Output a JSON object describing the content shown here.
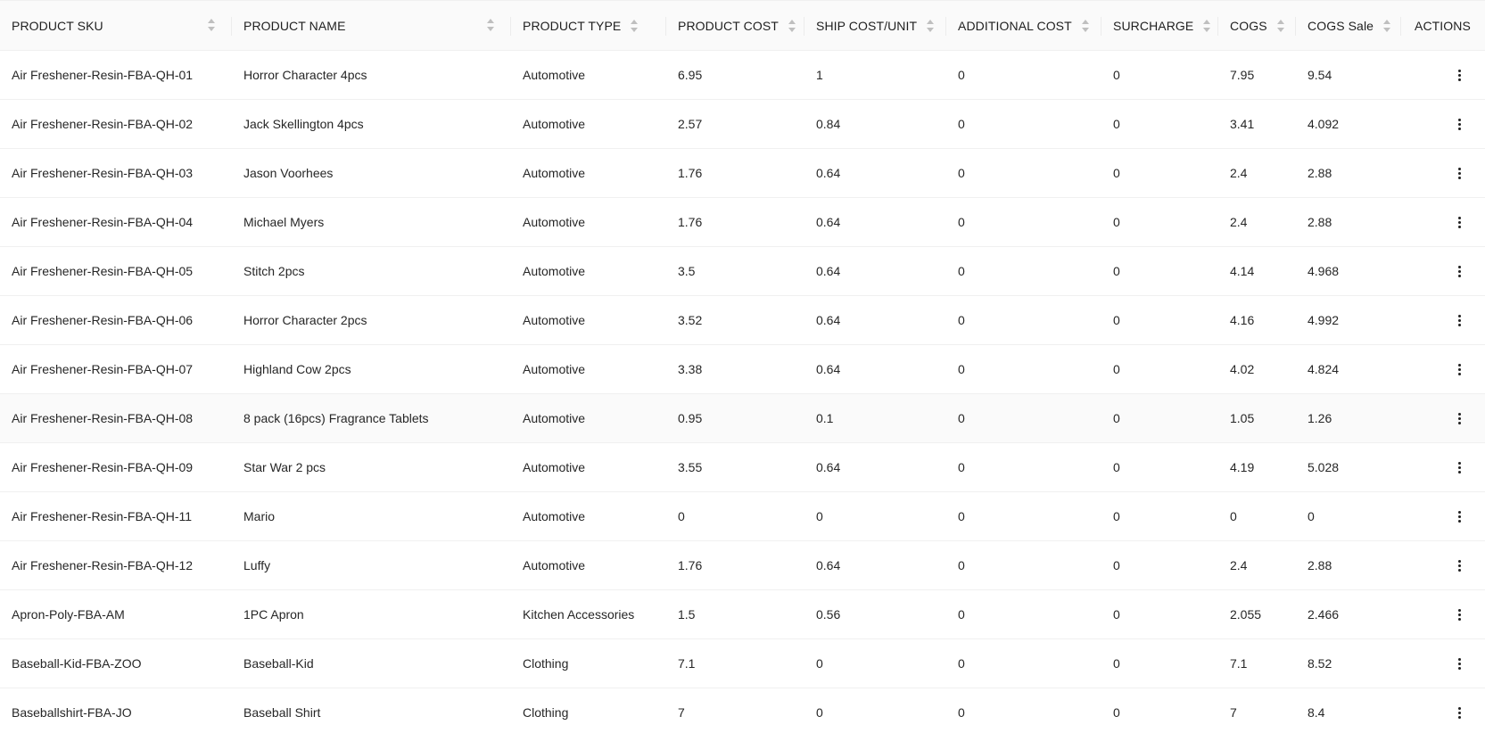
{
  "columns": [
    {
      "key": "sku",
      "label": "PRODUCT SKU",
      "sortable": true
    },
    {
      "key": "name",
      "label": "PRODUCT NAME",
      "sortable": true
    },
    {
      "key": "type",
      "label": "PRODUCT TYPE",
      "sortable": true
    },
    {
      "key": "cost",
      "label": "PRODUCT COST",
      "sortable": true
    },
    {
      "key": "ship",
      "label": "SHIP COST/UNIT",
      "sortable": true
    },
    {
      "key": "additional",
      "label": "ADDITIONAL COST",
      "sortable": true
    },
    {
      "key": "surcharge",
      "label": "SURCHARGE",
      "sortable": true
    },
    {
      "key": "cogs",
      "label": "COGS",
      "sortable": true
    },
    {
      "key": "cogs_sale",
      "label": "COGS Sale",
      "sortable": true
    },
    {
      "key": "actions",
      "label": "ACTIONS",
      "sortable": false
    }
  ],
  "rows": [
    {
      "sku": "Air Freshener-Resin-FBA-QH-01",
      "name": "Horror Character 4pcs",
      "type": "Automotive",
      "cost": "6.95",
      "ship": "1",
      "additional": "0",
      "surcharge": "0",
      "cogs": "7.95",
      "cogs_sale": "9.54"
    },
    {
      "sku": "Air Freshener-Resin-FBA-QH-02",
      "name": "Jack Skellington 4pcs",
      "type": "Automotive",
      "cost": "2.57",
      "ship": "0.84",
      "additional": "0",
      "surcharge": "0",
      "cogs": "3.41",
      "cogs_sale": "4.092"
    },
    {
      "sku": "Air Freshener-Resin-FBA-QH-03",
      "name": "Jason Voorhees",
      "type": "Automotive",
      "cost": "1.76",
      "ship": "0.64",
      "additional": "0",
      "surcharge": "0",
      "cogs": "2.4",
      "cogs_sale": "2.88"
    },
    {
      "sku": "Air Freshener-Resin-FBA-QH-04",
      "name": "Michael Myers",
      "type": "Automotive",
      "cost": "1.76",
      "ship": "0.64",
      "additional": "0",
      "surcharge": "0",
      "cogs": "2.4",
      "cogs_sale": "2.88"
    },
    {
      "sku": "Air Freshener-Resin-FBA-QH-05",
      "name": "Stitch 2pcs",
      "type": "Automotive",
      "cost": "3.5",
      "ship": "0.64",
      "additional": "0",
      "surcharge": "0",
      "cogs": "4.14",
      "cogs_sale": "4.968"
    },
    {
      "sku": "Air Freshener-Resin-FBA-QH-06",
      "name": "Horror Character 2pcs",
      "type": "Automotive",
      "cost": "3.52",
      "ship": "0.64",
      "additional": "0",
      "surcharge": "0",
      "cogs": "4.16",
      "cogs_sale": "4.992"
    },
    {
      "sku": "Air Freshener-Resin-FBA-QH-07",
      "name": "Highland Cow 2pcs",
      "type": "Automotive",
      "cost": "3.38",
      "ship": "0.64",
      "additional": "0",
      "surcharge": "0",
      "cogs": "4.02",
      "cogs_sale": "4.824"
    },
    {
      "sku": "Air Freshener-Resin-FBA-QH-08",
      "name": "8 pack (16pcs) Fragrance Tablets",
      "type": "Automotive",
      "cost": "0.95",
      "ship": "0.1",
      "additional": "0",
      "surcharge": "0",
      "cogs": "1.05",
      "cogs_sale": "1.26",
      "hovered": true
    },
    {
      "sku": "Air Freshener-Resin-FBA-QH-09",
      "name": "Star War 2 pcs",
      "type": "Automotive",
      "cost": "3.55",
      "ship": "0.64",
      "additional": "0",
      "surcharge": "0",
      "cogs": "4.19",
      "cogs_sale": "5.028"
    },
    {
      "sku": "Air Freshener-Resin-FBA-QH-11",
      "name": "Mario",
      "type": "Automotive",
      "cost": "0",
      "ship": "0",
      "additional": "0",
      "surcharge": "0",
      "cogs": "0",
      "cogs_sale": "0"
    },
    {
      "sku": "Air Freshener-Resin-FBA-QH-12",
      "name": "Luffy",
      "type": "Automotive",
      "cost": "1.76",
      "ship": "0.64",
      "additional": "0",
      "surcharge": "0",
      "cogs": "2.4",
      "cogs_sale": "2.88"
    },
    {
      "sku": "Apron-Poly-FBA-AM",
      "name": "1PC Apron",
      "type": "Kitchen Accessories",
      "cost": "1.5",
      "ship": "0.56",
      "additional": "0",
      "surcharge": "0",
      "cogs": "2.055",
      "cogs_sale": "2.466"
    },
    {
      "sku": "Baseball-Kid-FBA-ZOO",
      "name": "Baseball-Kid",
      "type": "Clothing",
      "cost": "7.1",
      "ship": "0",
      "additional": "0",
      "surcharge": "0",
      "cogs": "7.1",
      "cogs_sale": "8.52"
    },
    {
      "sku": "Baseballshirt-FBA-JO",
      "name": "Baseball Shirt",
      "type": "Clothing",
      "cost": "7",
      "ship": "0",
      "additional": "0",
      "surcharge": "0",
      "cogs": "7",
      "cogs_sale": "8.4"
    }
  ],
  "icons": {
    "sort": "sort-icon",
    "row_menu": "more-vertical-icon"
  },
  "colors": {
    "header_bg": "#fafafa",
    "row_hover_bg": "#fafafa",
    "border": "#f0f0f0",
    "sort_icon": "#bfbfbf"
  }
}
